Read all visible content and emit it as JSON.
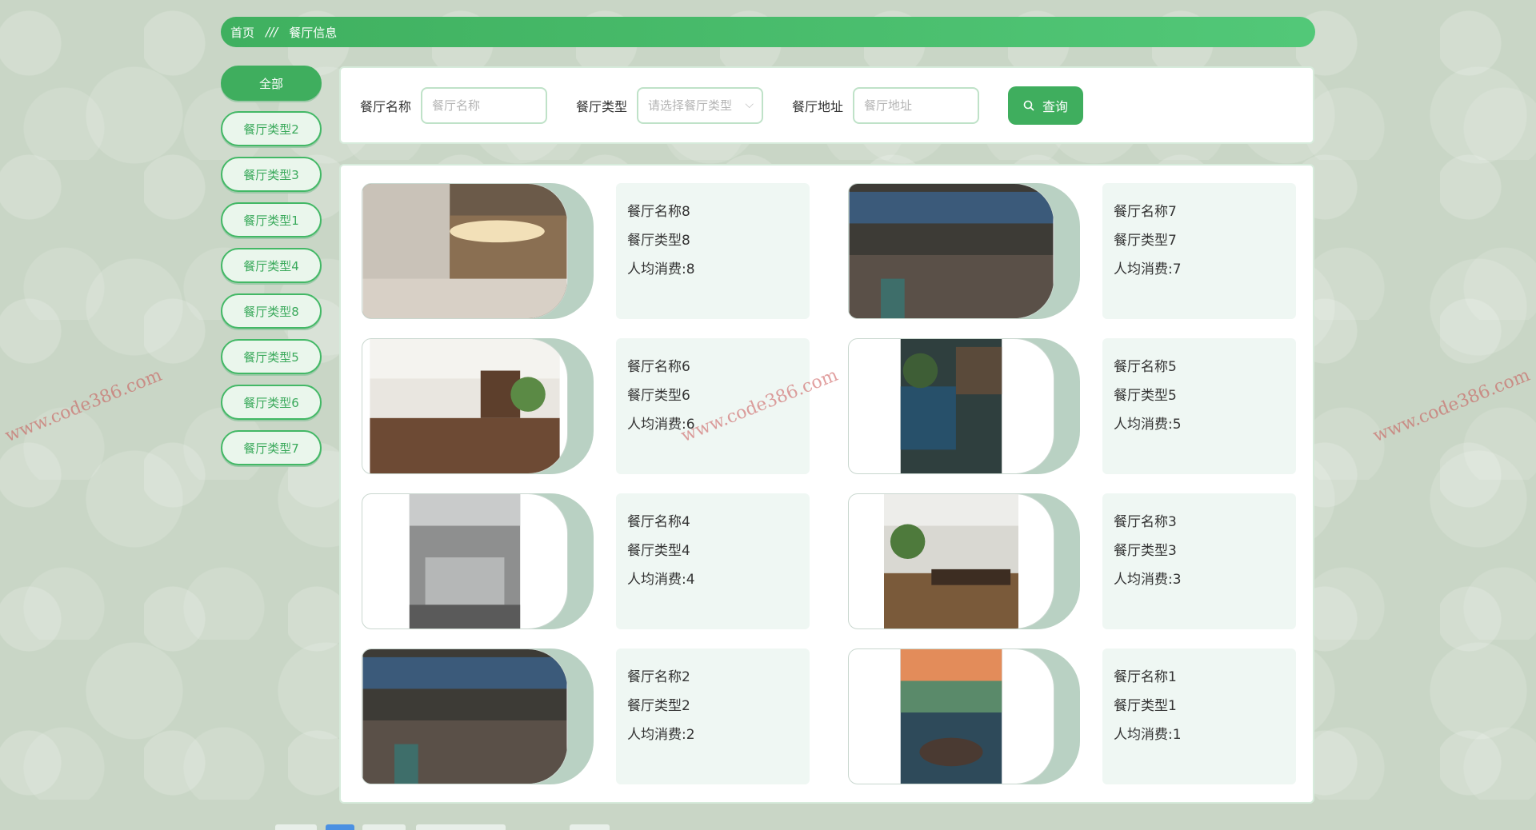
{
  "breadcrumb": {
    "home": "首页",
    "separator": "///",
    "current": "餐厅信息"
  },
  "sidebar": {
    "items": [
      {
        "label": "全部",
        "active": true
      },
      {
        "label": "餐厅类型2"
      },
      {
        "label": "餐厅类型3"
      },
      {
        "label": "餐厅类型1"
      },
      {
        "label": "餐厅类型4"
      },
      {
        "label": "餐厅类型8"
      },
      {
        "label": "餐厅类型5"
      },
      {
        "label": "餐厅类型6"
      },
      {
        "label": "餐厅类型7"
      }
    ]
  },
  "search": {
    "name_label": "餐厅名称",
    "name_placeholder": "餐厅名称",
    "type_label": "餐厅类型",
    "type_placeholder": "请选择餐厅类型",
    "address_label": "餐厅地址",
    "address_placeholder": "餐厅地址",
    "button_label": "查询"
  },
  "restaurants": [
    {
      "name": "餐厅名称8",
      "type": "餐厅类型8",
      "spend": "人均消费:8"
    },
    {
      "name": "餐厅名称7",
      "type": "餐厅类型7",
      "spend": "人均消费:7"
    },
    {
      "name": "餐厅名称6",
      "type": "餐厅类型6",
      "spend": "人均消费:6"
    },
    {
      "name": "餐厅名称5",
      "type": "餐厅类型5",
      "spend": "人均消费:5"
    },
    {
      "name": "餐厅名称4",
      "type": "餐厅类型4",
      "spend": "人均消费:4"
    },
    {
      "name": "餐厅名称3",
      "type": "餐厅类型3",
      "spend": "人均消费:3"
    },
    {
      "name": "餐厅名称2",
      "type": "餐厅类型2",
      "spend": "人均消费:2"
    },
    {
      "name": "餐厅名称1",
      "type": "餐厅类型1",
      "spend": "人均消费:1"
    }
  ],
  "watermark": "www.code386.com",
  "colors": {
    "accent": "#3fae5e",
    "panel_border": "#d6ebdb",
    "info_bg": "#eff7f3"
  }
}
